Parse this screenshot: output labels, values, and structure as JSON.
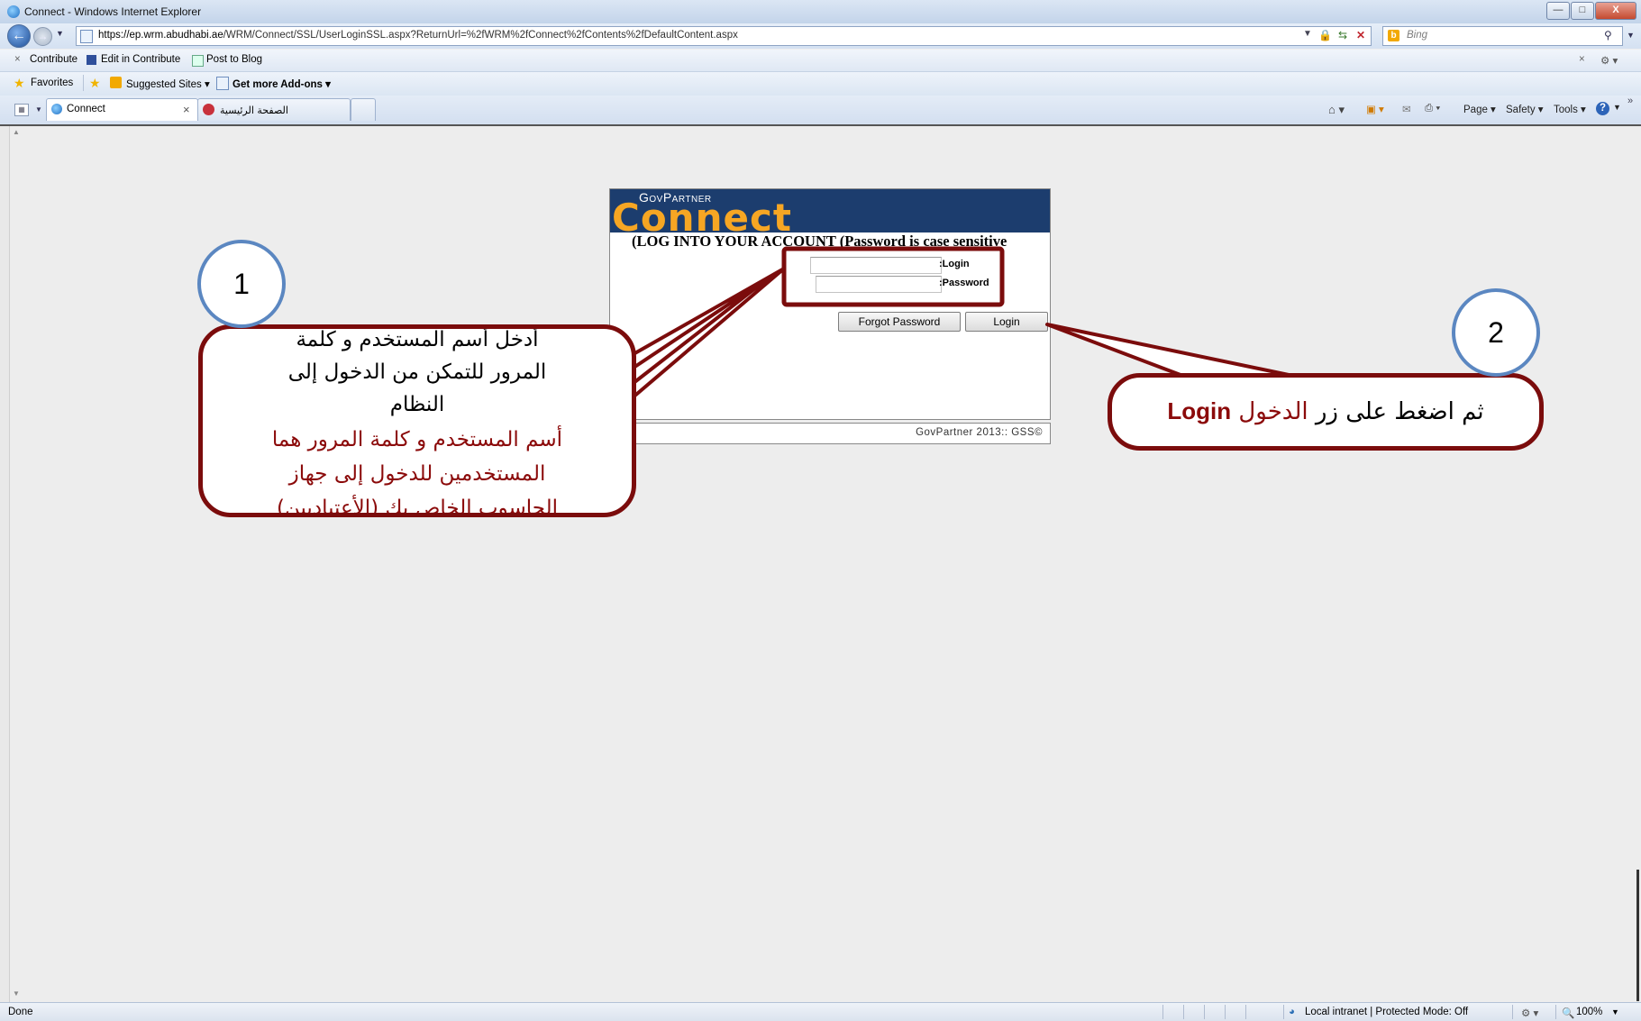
{
  "window": {
    "title": "Connect - Windows Internet Explorer",
    "controls": {
      "minimize": "—",
      "maximize": "□",
      "close": "X"
    }
  },
  "address_bar": {
    "url_host": "https://ep.wrm.abudhabi.ae",
    "url_path": "/WRM/Connect/SSL/UserLoginSSL.aspx?ReturnUrl=%2fWRM%2fConnect%2fContents%2fDefaultContent.aspx",
    "search_placeholder": "Bing"
  },
  "contribute_toolbar": {
    "close": "×",
    "contribute": "Contribute",
    "edit": "Edit in Contribute",
    "post": "Post to Blog"
  },
  "favorites_bar": {
    "favorites": "Favorites",
    "suggested": "Suggested Sites ▾",
    "addons": "Get more Add-ons ▾"
  },
  "tabs": [
    {
      "label": "Connect",
      "close": "×"
    },
    {
      "label": "الصفحة الرئيسية"
    }
  ],
  "command_bar": {
    "page": "Page ▾",
    "safety": "Safety ▾",
    "tools": "Tools ▾",
    "help": "?"
  },
  "login_panel": {
    "brand_top": "GovPartner",
    "brand_main": "Connect",
    "heading": "(LOG INTO YOUR ACCOUNT (Password is case sensitive",
    "login_label": ":Login",
    "password_label": ":Password",
    "login_value": "",
    "password_value": "",
    "forgot_button": "Forgot Password",
    "login_button": "Login",
    "footer": "GovPartner 2013:: GSS©"
  },
  "annotations": {
    "step1_number": "1",
    "step1_line1": "أدخل أسم المستخدم و كلمة",
    "step1_line2": "المرور للتمكن من الدخول إلى",
    "step1_line3": "النظام",
    "step1_red1": "أسم المستخدم و كلمة المرور هما",
    "step1_red2": "المستخدمين للدخول إلى جهاز",
    "step1_red3": "الحاسوب الخاص بك (الأعتياديين)",
    "step2_number": "2",
    "step2_text": "ثم اضغط على زر",
    "step2_red": "الدخول",
    "step2_bold": "Login"
  },
  "status_bar": {
    "status": "Done",
    "zone": "Local intranet | Protected Mode: Off",
    "zoom": "100%"
  },
  "colors": {
    "banner": "#1c3d6e",
    "brand_orange": "#f6a623",
    "callout_border": "#7b0c0c",
    "circle_border": "#5b87c1"
  }
}
